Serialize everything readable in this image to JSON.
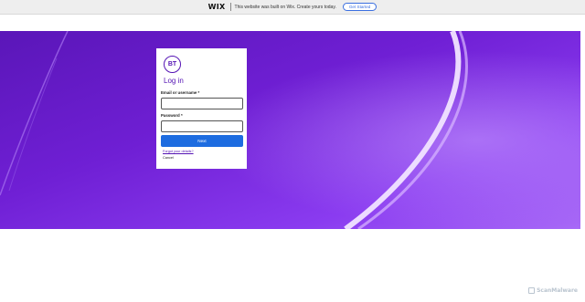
{
  "wix_banner": {
    "logo": "WIX",
    "message": "This website was built on Wix. Create yours today.",
    "button_label": "Get Started"
  },
  "login": {
    "logo_text": "BT",
    "title": "Log in",
    "username_label": "Email or username *",
    "username_value": "",
    "password_label": "Password *",
    "password_value": "",
    "next_label": "Next",
    "forgot_label": "Forgot your details?",
    "cancel_label": "Cancel"
  },
  "watermark": {
    "text": "ScanMalware"
  },
  "colors": {
    "brand_purple": "#5514b4",
    "hero_purple": "#6f1fd4",
    "button_blue": "#1d6ce0",
    "wix_blue": "#3a6fe0"
  }
}
